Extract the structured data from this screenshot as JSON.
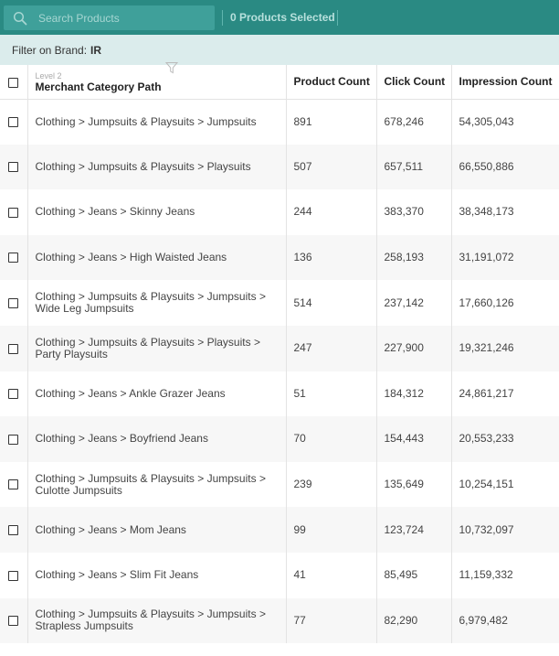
{
  "search": {
    "placeholder": "Search Products"
  },
  "selection": {
    "label": "0 Products Selected"
  },
  "filter": {
    "prefix": "Filter on Brand:",
    "value": "IR"
  },
  "table": {
    "level_label": "Level 2",
    "columns": [
      "Merchant Category Path",
      "Product Count",
      "Click Count",
      "Impression Count"
    ],
    "rows": [
      {
        "path": "Clothing > Jumpsuits & Playsuits > Jumpsuits",
        "product_count": "891",
        "click_count": "678,246",
        "impression_count": "54,305,043"
      },
      {
        "path": "Clothing > Jumpsuits & Playsuits > Playsuits",
        "product_count": "507",
        "click_count": "657,511",
        "impression_count": "66,550,886"
      },
      {
        "path": "Clothing > Jeans > Skinny Jeans",
        "product_count": "244",
        "click_count": "383,370",
        "impression_count": "38,348,173"
      },
      {
        "path": "Clothing > Jeans > High Waisted Jeans",
        "product_count": "136",
        "click_count": "258,193",
        "impression_count": "31,191,072"
      },
      {
        "path": "Clothing > Jumpsuits & Playsuits > Jumpsuits > Wide Leg Jumpsuits",
        "product_count": "514",
        "click_count": "237,142",
        "impression_count": "17,660,126"
      },
      {
        "path": "Clothing > Jumpsuits & Playsuits > Playsuits > Party Playsuits",
        "product_count": "247",
        "click_count": "227,900",
        "impression_count": "19,321,246"
      },
      {
        "path": "Clothing > Jeans > Ankle Grazer Jeans",
        "product_count": "51",
        "click_count": "184,312",
        "impression_count": "24,861,217"
      },
      {
        "path": "Clothing > Jeans > Boyfriend Jeans",
        "product_count": "70",
        "click_count": "154,443",
        "impression_count": "20,553,233"
      },
      {
        "path": "Clothing > Jumpsuits & Playsuits > Jumpsuits > Culotte Jumpsuits",
        "product_count": "239",
        "click_count": "135,649",
        "impression_count": "10,254,151"
      },
      {
        "path": "Clothing > Jeans > Mom Jeans",
        "product_count": "99",
        "click_count": "123,724",
        "impression_count": "10,732,097"
      },
      {
        "path": "Clothing > Jeans > Slim Fit Jeans",
        "product_count": "41",
        "click_count": "85,495",
        "impression_count": "11,159,332"
      },
      {
        "path": "Clothing > Jumpsuits & Playsuits > Jumpsuits > Strapless Jumpsuits",
        "product_count": "77",
        "click_count": "82,290",
        "impression_count": "6,979,482"
      }
    ]
  },
  "icons": {
    "search": "search-icon",
    "filter": "filter-funnel-icon"
  },
  "colors": {
    "topbar": "#2a8a83",
    "search_box": "#3fa09a",
    "filter_bar": "#dbecec",
    "row_alt": "#f7f7f7"
  }
}
